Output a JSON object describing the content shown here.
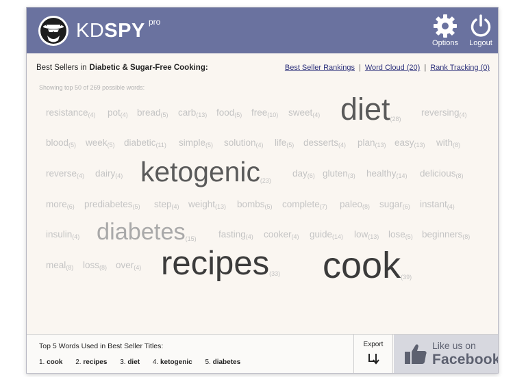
{
  "header": {
    "logo_kd": "KD",
    "logo_spy": "SPY",
    "logo_pro": "pro",
    "options_label": "Options",
    "logout_label": "Logout",
    "background": "#6a729f"
  },
  "subbar": {
    "prefix": "Best Sellers in",
    "category": "Diabetic & Sugar-Free Cooking:",
    "links": {
      "rankings": "Best Seller Rankings",
      "word_cloud": "Word Cloud (20)",
      "rank_tracking": "Rank Tracking (0)",
      "separator": "|"
    }
  },
  "showing_text": "Showing top 50 of 269 possible words:",
  "words": [
    {
      "word": "resistance",
      "count": "(4)"
    },
    {
      "word": "pot",
      "count": "(4)"
    },
    {
      "word": "bread",
      "count": "(5)"
    },
    {
      "word": "carb",
      "count": "(13)"
    },
    {
      "word": "food",
      "count": "(5)"
    },
    {
      "word": "free",
      "count": "(10)"
    },
    {
      "word": "sweet",
      "count": "(4)"
    },
    {
      "word": "diet",
      "count": "(28)"
    },
    {
      "word": "reversing",
      "count": "(4)"
    },
    {
      "word": "blood",
      "count": "(5)"
    },
    {
      "word": "week",
      "count": "(5)"
    },
    {
      "word": "diabetic",
      "count": "(11)"
    },
    {
      "word": "simple",
      "count": "(5)"
    },
    {
      "word": "solution",
      "count": "(4)"
    },
    {
      "word": "life",
      "count": "(5)"
    },
    {
      "word": "desserts",
      "count": "(4)"
    },
    {
      "word": "plan",
      "count": "(13)"
    },
    {
      "word": "easy",
      "count": "(13)"
    },
    {
      "word": "with",
      "count": "(8)"
    },
    {
      "word": "reverse",
      "count": "(4)"
    },
    {
      "word": "dairy",
      "count": "(4)"
    },
    {
      "word": "ketogenic",
      "count": "(23)"
    },
    {
      "word": "day",
      "count": "(6)"
    },
    {
      "word": "gluten",
      "count": "(3)"
    },
    {
      "word": "healthy",
      "count": "(14)"
    },
    {
      "word": "delicious",
      "count": "(8)"
    },
    {
      "word": "more",
      "count": "(6)"
    },
    {
      "word": "prediabetes",
      "count": "(5)"
    },
    {
      "word": "step",
      "count": "(4)"
    },
    {
      "word": "weight",
      "count": "(13)"
    },
    {
      "word": "bombs",
      "count": "(5)"
    },
    {
      "word": "complete",
      "count": "(7)"
    },
    {
      "word": "paleo",
      "count": "(8)"
    },
    {
      "word": "sugar",
      "count": "(6)"
    },
    {
      "word": "instant",
      "count": "(4)"
    },
    {
      "word": "insulin",
      "count": "(4)"
    },
    {
      "word": "diabetes",
      "count": "(15)"
    },
    {
      "word": "fasting",
      "count": "(4)"
    },
    {
      "word": "cooker",
      "count": "(4)"
    },
    {
      "word": "guide",
      "count": "(14)"
    },
    {
      "word": "low",
      "count": "(13)"
    },
    {
      "word": "lose",
      "count": "(5)"
    },
    {
      "word": "beginners",
      "count": "(8)"
    },
    {
      "word": "meal",
      "count": "(8)"
    },
    {
      "word": "loss",
      "count": "(8)"
    },
    {
      "word": "over",
      "count": "(4)"
    },
    {
      "word": "recipes",
      "count": "(33)"
    },
    {
      "word": "cook",
      "count": "(39)"
    }
  ],
  "footer": {
    "top5_title": "Top 5 Words Used in Best Seller Titles:",
    "top5": [
      {
        "rank": "1.",
        "word": "cook"
      },
      {
        "rank": "2.",
        "word": "recipes"
      },
      {
        "rank": "3.",
        "word": "diet"
      },
      {
        "rank": "4.",
        "word": "ketogenic"
      },
      {
        "rank": "5.",
        "word": "diabetes"
      }
    ],
    "export_label": "Export",
    "fb_like": "Like us on",
    "fb_brand": "Facebook"
  },
  "icons": {
    "logo": "spy-logo-icon",
    "options": "gear-icon",
    "logout": "power-icon",
    "export": "export-icon",
    "facebook": "thumbs-up-icon"
  }
}
